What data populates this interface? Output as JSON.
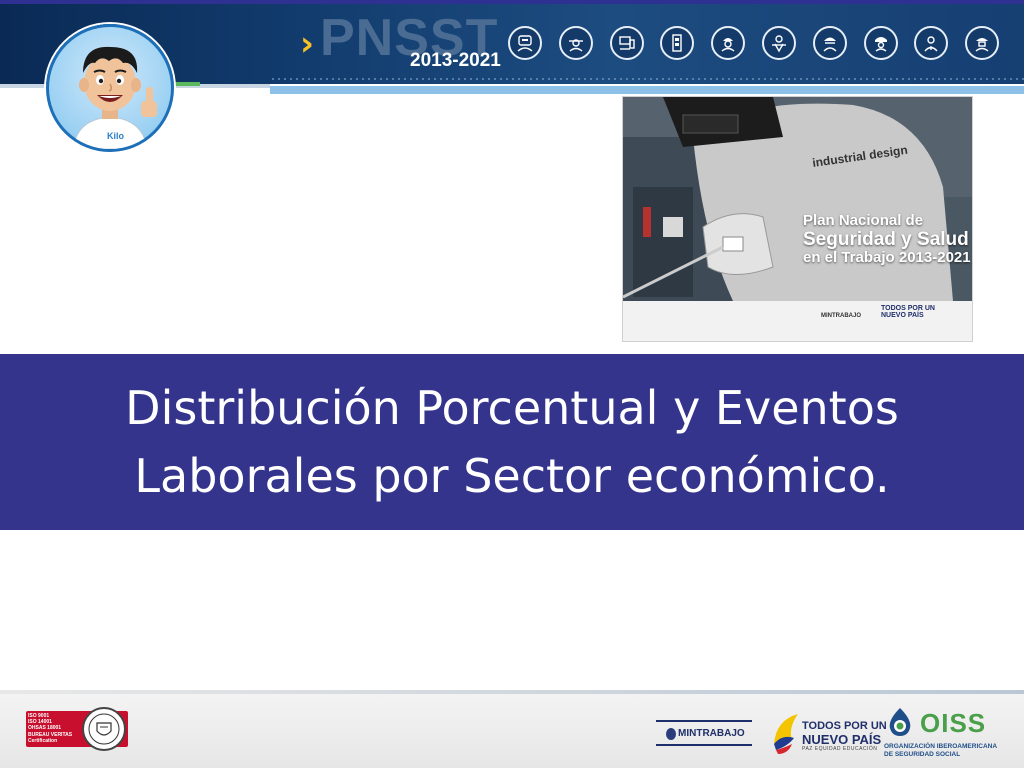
{
  "header": {
    "brand_name": "PNSST",
    "years": "2013-2021",
    "role_icons": [
      "welder-icon",
      "farmer-icon",
      "machinist-icon",
      "electrician-icon",
      "miner-icon",
      "worker-icon",
      "construction-worker-icon",
      "firefighter-icon",
      "health-worker-icon",
      "engineer-icon"
    ]
  },
  "avatar": {
    "shirt_text": "Kilo"
  },
  "cover": {
    "line1": "Plan Nacional de",
    "line2": "Seguridad y Salud",
    "line3": "en el Trabajo 2013-2021",
    "shirt_text": "industrial design",
    "ministry": "MINTRABAJO",
    "campaign_line1": "TODOS POR UN",
    "campaign_line2": "NUEVO PAÍS"
  },
  "title": {
    "line1": "Distribución Porcentual y Eventos",
    "line2": "Laborales por Sector económico."
  },
  "footer": {
    "certification_lines": [
      "ISO 9001",
      "ISO 14001",
      "OHSAS 18001",
      "BUREAU VERITAS",
      "Certification"
    ],
    "seal_text": "BUREAU VERITAS 1828",
    "ministry": "MINTRABAJO",
    "campaign_line1": "TODOS POR UN",
    "campaign_line2": "NUEVO PAÍS",
    "campaign_line3": "PAZ  EQUIDAD  EDUCACIÓN",
    "oiss_name": "OISS",
    "oiss_sub1": "ORGANIZACIÓN IBEROAMERICANA",
    "oiss_sub2": "DE SEGURIDAD SOCIAL"
  },
  "colors": {
    "title_band": "#34348c",
    "header_dark": "#0a2a55",
    "accent_yellow": "#f6c026",
    "oiss_green": "#4aa04a",
    "certification_red": "#c8102e"
  }
}
